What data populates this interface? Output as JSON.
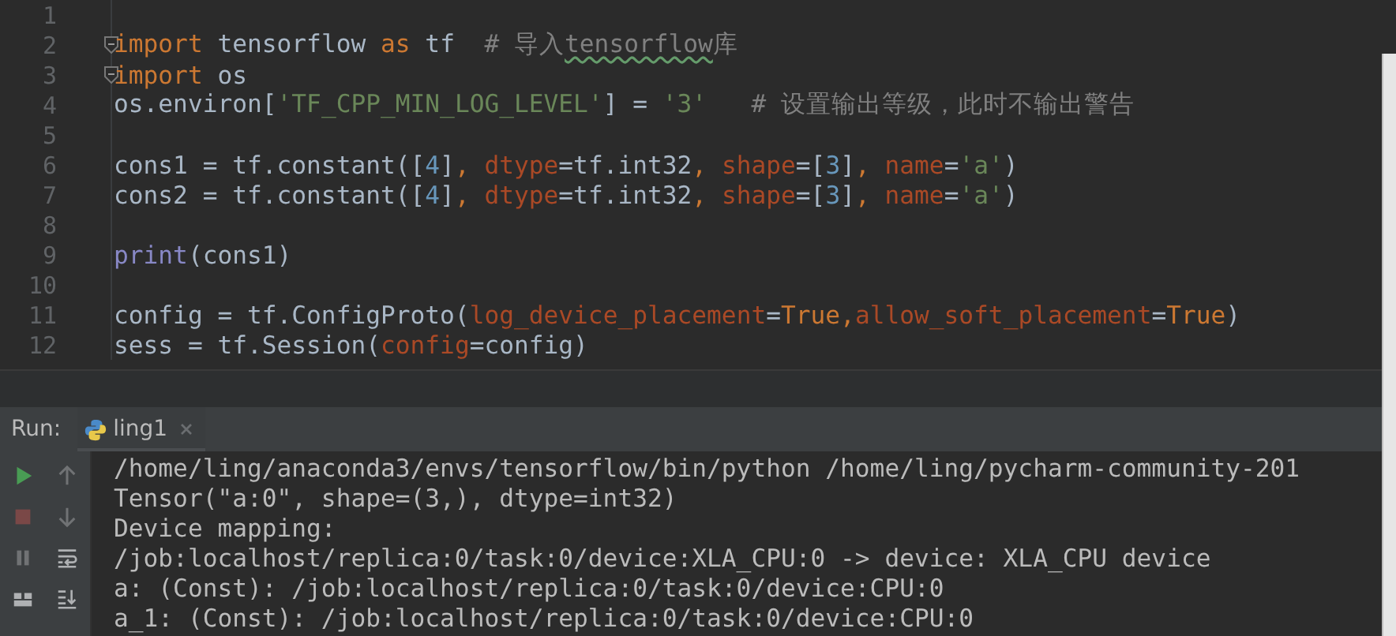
{
  "editor": {
    "lines": [
      {
        "number": "1",
        "fold": false
      },
      {
        "number": "2",
        "fold": true,
        "tokens": [
          {
            "kind": "keyword",
            "text": "import"
          },
          {
            "kind": "plain",
            "text": " tensorflow "
          },
          {
            "kind": "keyword",
            "text": "as"
          },
          {
            "kind": "plain",
            "text": " tf  "
          },
          {
            "kind": "comment",
            "text": "# 导入"
          },
          {
            "kind": "typo",
            "text": "tensorflow"
          },
          {
            "kind": "comment",
            "text": "库"
          }
        ]
      },
      {
        "number": "3",
        "fold": true,
        "tokens": [
          {
            "kind": "keyword",
            "text": "import"
          },
          {
            "kind": "plain",
            "text": " os"
          }
        ]
      },
      {
        "number": "4",
        "fold": false,
        "tokens": [
          {
            "kind": "plain",
            "text": "os.environ["
          },
          {
            "kind": "string",
            "text": "'TF_CPP_MIN_LOG_LEVEL'"
          },
          {
            "kind": "plain",
            "text": "] = "
          },
          {
            "kind": "string",
            "text": "'3'"
          },
          {
            "kind": "comment",
            "text": "   # 设置输出等级，此时不输出警告"
          }
        ]
      },
      {
        "number": "5",
        "fold": false
      },
      {
        "number": "6",
        "fold": false,
        "tokens": [
          {
            "kind": "plain",
            "text": "cons1 = tf.constant(["
          },
          {
            "kind": "number",
            "text": "4"
          },
          {
            "kind": "plain",
            "text": "]"
          },
          {
            "kind": "keyword",
            "text": ", "
          },
          {
            "kind": "param",
            "text": "dtype"
          },
          {
            "kind": "plain",
            "text": "=tf.int32"
          },
          {
            "kind": "keyword",
            "text": ", "
          },
          {
            "kind": "param",
            "text": "shape"
          },
          {
            "kind": "plain",
            "text": "=["
          },
          {
            "kind": "number",
            "text": "3"
          },
          {
            "kind": "plain",
            "text": "]"
          },
          {
            "kind": "keyword",
            "text": ", "
          },
          {
            "kind": "param",
            "text": "name"
          },
          {
            "kind": "plain",
            "text": "="
          },
          {
            "kind": "string",
            "text": "'a'"
          },
          {
            "kind": "plain",
            "text": ")"
          }
        ]
      },
      {
        "number": "7",
        "fold": false,
        "tokens": [
          {
            "kind": "plain",
            "text": "cons2 = tf.constant(["
          },
          {
            "kind": "number",
            "text": "4"
          },
          {
            "kind": "plain",
            "text": "]"
          },
          {
            "kind": "keyword",
            "text": ", "
          },
          {
            "kind": "param",
            "text": "dtype"
          },
          {
            "kind": "plain",
            "text": "=tf.int32"
          },
          {
            "kind": "keyword",
            "text": ", "
          },
          {
            "kind": "param",
            "text": "shape"
          },
          {
            "kind": "plain",
            "text": "=["
          },
          {
            "kind": "number",
            "text": "3"
          },
          {
            "kind": "plain",
            "text": "]"
          },
          {
            "kind": "keyword",
            "text": ", "
          },
          {
            "kind": "param",
            "text": "name"
          },
          {
            "kind": "plain",
            "text": "="
          },
          {
            "kind": "string",
            "text": "'a'"
          },
          {
            "kind": "plain",
            "text": ")"
          }
        ]
      },
      {
        "number": "8",
        "fold": false
      },
      {
        "number": "9",
        "fold": false,
        "tokens": [
          {
            "kind": "builtin",
            "text": "print"
          },
          {
            "kind": "plain",
            "text": "(cons1)"
          }
        ]
      },
      {
        "number": "10",
        "fold": false
      },
      {
        "number": "11",
        "fold": false,
        "tokens": [
          {
            "kind": "plain",
            "text": "config = tf.ConfigProto("
          },
          {
            "kind": "param",
            "text": "log_device_placement"
          },
          {
            "kind": "plain",
            "text": "="
          },
          {
            "kind": "keyword",
            "text": "True,"
          },
          {
            "kind": "param",
            "text": "allow_soft_placement"
          },
          {
            "kind": "plain",
            "text": "="
          },
          {
            "kind": "keyword",
            "text": "True"
          },
          {
            "kind": "plain",
            "text": ")"
          }
        ]
      },
      {
        "number": "12",
        "fold": false,
        "tokens": [
          {
            "kind": "plain",
            "text": "sess = tf.Session("
          },
          {
            "kind": "param",
            "text": "config"
          },
          {
            "kind": "plain",
            "text": "=config)"
          }
        ]
      }
    ]
  },
  "run": {
    "label": "Run:",
    "tabs": [
      {
        "label": "ling1",
        "selected": true
      }
    ]
  },
  "toolbar": [
    {
      "kind": "run",
      "disabled": false
    },
    {
      "kind": "up",
      "disabled": true
    },
    {
      "kind": "stop",
      "disabled": true
    },
    {
      "kind": "down",
      "disabled": true
    },
    {
      "kind": "pause",
      "disabled": true
    },
    {
      "kind": "wrap",
      "disabled": false
    },
    {
      "kind": "layout",
      "disabled": false
    },
    {
      "kind": "scroll-end",
      "disabled": false
    }
  ],
  "console": {
    "lines": [
      "/home/ling/anaconda3/envs/tensorflow/bin/python /home/ling/pycharm-community-201",
      "Tensor(\"a:0\", shape=(3,), dtype=int32)",
      "Device mapping:",
      "/job:localhost/replica:0/task:0/device:XLA_CPU:0 -> device: XLA_CPU device",
      "a: (Const): /job:localhost/replica:0/task:0/device:CPU:0",
      "a_1: (Const): /job:localhost/replica:0/task:0/device:CPU:0"
    ]
  }
}
